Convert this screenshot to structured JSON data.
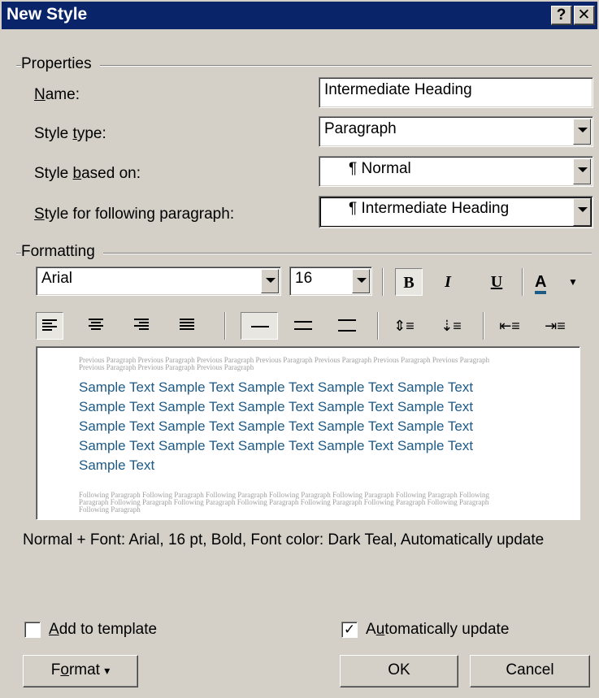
{
  "window": {
    "title": "New Style",
    "help_icon": "question-mark",
    "close_icon": "x-mark"
  },
  "properties": {
    "group_label": "Properties",
    "name_label_u": "N",
    "name_label_rest": "ame:",
    "name_value": "Intermediate Heading",
    "style_type_label_pre": "Style ",
    "style_type_label_u": "t",
    "style_type_label_post": "ype:",
    "style_type_value": "Paragraph",
    "based_on_label_pre": "Style ",
    "based_on_label_u": "b",
    "based_on_label_post": "ased on:",
    "based_on_pilcrow": "¶",
    "based_on_value": "Normal",
    "following_label_u": "S",
    "following_label_rest": "tyle for following paragraph:",
    "following_pilcrow": "¶",
    "following_value": "Intermediate Heading"
  },
  "formatting": {
    "group_label": "Formatting",
    "font_value": "Arial",
    "size_value": "16",
    "bold_glyph": "B",
    "italic_glyph": "I",
    "underline_glyph": "U",
    "font_color_glyph": "A",
    "font_color_accent": "#1d5a86"
  },
  "preview": {
    "previous_paragraph": "Previous Paragraph Previous Paragraph Previous Paragraph Previous Paragraph Previous Paragraph Previous Paragraph Previous Paragraph Previous Paragraph Previous Paragraph Previous Paragraph",
    "sample_text": "Sample Text Sample Text Sample Text Sample Text Sample Text Sample Text Sample Text Sample Text Sample Text Sample Text Sample Text Sample Text Sample Text Sample Text Sample Text Sample Text Sample Text Sample Text Sample Text Sample Text Sample Text",
    "following_paragraph": "Following Paragraph Following Paragraph Following Paragraph Following Paragraph Following Paragraph Following Paragraph Following Paragraph Following Paragraph Following Paragraph Following Paragraph Following Paragraph Following Paragraph Following Paragraph Following Paragraph",
    "sample_color": "#1d5a86"
  },
  "description": "Normal + Font: Arial, 16 pt, Bold, Font color: Dark Teal, Automatically update",
  "options": {
    "add_to_template_u": "A",
    "add_to_template_rest": "dd to template",
    "add_to_template_checked": false,
    "auto_update_pre": "A",
    "auto_update_u": "u",
    "auto_update_rest": "tomatically update",
    "auto_update_checked": true,
    "check_glyph": "✓"
  },
  "buttons": {
    "format_pre": "F",
    "format_u": "o",
    "format_rest": "rmat",
    "format_arrow": "▾",
    "ok": "OK",
    "cancel": "Cancel"
  }
}
